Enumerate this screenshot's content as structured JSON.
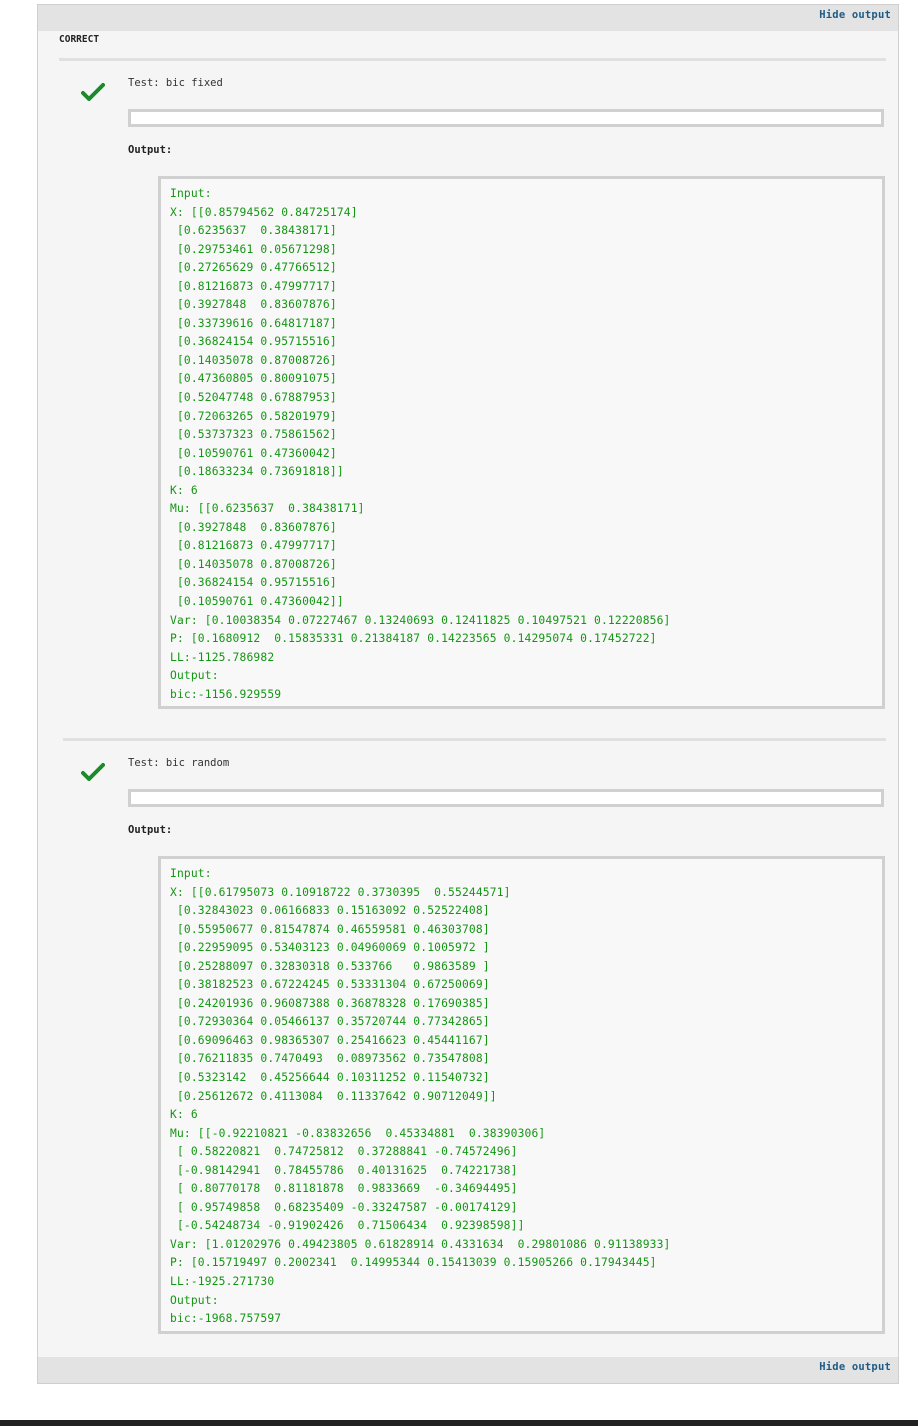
{
  "header": {
    "hide_output": "Hide output"
  },
  "footer": {
    "hide_output": "Hide output"
  },
  "status": "CORRECT",
  "tests": [
    {
      "label": "Test: bic fixed",
      "output_label": "Output:",
      "lines": [
        "Input:",
        "X: [[0.85794562 0.84725174]",
        " [0.6235637  0.38438171]",
        " [0.29753461 0.05671298]",
        " [0.27265629 0.47766512]",
        " [0.81216873 0.47997717]",
        " [0.3927848  0.83607876]",
        " [0.33739616 0.64817187]",
        " [0.36824154 0.95715516]",
        " [0.14035078 0.87008726]",
        " [0.47360805 0.80091075]",
        " [0.52047748 0.67887953]",
        " [0.72063265 0.58201979]",
        " [0.53737323 0.75861562]",
        " [0.10590761 0.47360042]",
        " [0.18633234 0.73691818]]",
        "K: 6",
        "Mu: [[0.6235637  0.38438171]",
        " [0.3927848  0.83607876]",
        " [0.81216873 0.47997717]",
        " [0.14035078 0.87008726]",
        " [0.36824154 0.95715516]",
        " [0.10590761 0.47360042]]",
        "Var: [0.10038354 0.07227467 0.13240693 0.12411825 0.10497521 0.12220856]",
        "P: [0.1680912  0.15835331 0.21384187 0.14223565 0.14295074 0.17452722]",
        "LL:-1125.786982",
        "Output:",
        "bic:-1156.929559"
      ]
    },
    {
      "label": "Test: bic random",
      "output_label": "Output:",
      "lines": [
        "Input:",
        "X: [[0.61795073 0.10918722 0.3730395  0.55244571]",
        " [0.32843023 0.06166833 0.15163092 0.52522408]",
        " [0.55950677 0.81547874 0.46559581 0.46303708]",
        " [0.22959095 0.53403123 0.04960069 0.1005972 ]",
        " [0.25288097 0.32830318 0.533766   0.9863589 ]",
        " [0.38182523 0.67224245 0.53331304 0.67250069]",
        " [0.24201936 0.96087388 0.36878328 0.17690385]",
        " [0.72930364 0.05466137 0.35720744 0.77342865]",
        " [0.69096463 0.98365307 0.25416623 0.45441167]",
        " [0.76211835 0.7470493  0.08973562 0.73547808]",
        " [0.5323142  0.45256644 0.10311252 0.11540732]",
        " [0.25612672 0.4113084  0.11337642 0.90712049]]",
        "K: 6",
        "Mu: [[-0.92210821 -0.83832656  0.45334881  0.38390306]",
        " [ 0.58220821  0.74725812  0.37288841 -0.74572496]",
        " [-0.98142941  0.78455786  0.40131625  0.74221738]",
        " [ 0.80770178  0.81181878  0.9833669  -0.34694495]",
        " [ 0.95749858  0.68235409 -0.33247587 -0.00174129]",
        " [-0.54248734 -0.91902426  0.71506434  0.92398598]]",
        "Var: [1.01202976 0.49423805 0.61828914 0.4331634  0.29801086 0.91138933]",
        "P: [0.15719497 0.2002341  0.14995344 0.15413039 0.15905266 0.17943445]",
        "LL:-1925.271730",
        "Output:",
        "bic:-1968.757597"
      ]
    }
  ]
}
